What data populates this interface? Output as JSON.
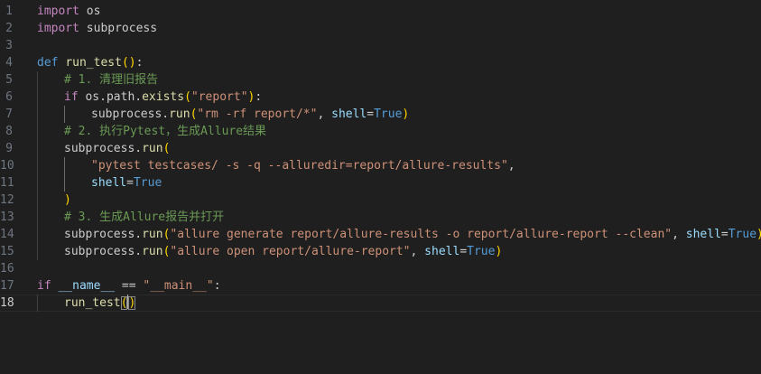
{
  "editor": {
    "language": "python",
    "current_line": 18,
    "colors": {
      "background": "#1f1f1f",
      "keyword": "#c586c0",
      "def": "#569cd6",
      "function": "#dcdcaa",
      "string": "#ce9178",
      "comment": "#6a9955",
      "param": "#9cdcfe",
      "constant": "#569cd6",
      "default": "#cccccc",
      "bracket1": "#ffd700",
      "bracket2": "#da70d6"
    },
    "lines": [
      {
        "number": "1",
        "indent": 0,
        "tokens": [
          {
            "t": "import",
            "c": "keyword"
          },
          {
            "t": " os",
            "c": "default"
          }
        ]
      },
      {
        "number": "2",
        "indent": 0,
        "tokens": [
          {
            "t": "import",
            "c": "keyword"
          },
          {
            "t": " subprocess",
            "c": "default"
          }
        ]
      },
      {
        "number": "3",
        "indent": 0,
        "tokens": []
      },
      {
        "number": "4",
        "indent": 0,
        "tokens": [
          {
            "t": "def",
            "c": "def"
          },
          {
            "t": " ",
            "c": "default"
          },
          {
            "t": "run_test",
            "c": "function"
          },
          {
            "t": "()",
            "c": "bracket1"
          },
          {
            "t": ":",
            "c": "default"
          }
        ]
      },
      {
        "number": "5",
        "indent": 1,
        "tokens": [
          {
            "t": "# 1. 清理旧报告",
            "c": "comment"
          }
        ]
      },
      {
        "number": "6",
        "indent": 1,
        "tokens": [
          {
            "t": "if",
            "c": "keyword"
          },
          {
            "t": " os.path.",
            "c": "default"
          },
          {
            "t": "exists",
            "c": "function"
          },
          {
            "t": "(",
            "c": "bracket1"
          },
          {
            "t": "\"report\"",
            "c": "string"
          },
          {
            "t": ")",
            "c": "bracket1"
          },
          {
            "t": ":",
            "c": "default"
          }
        ]
      },
      {
        "number": "7",
        "indent": 2,
        "tokens": [
          {
            "t": "subprocess.",
            "c": "default"
          },
          {
            "t": "run",
            "c": "function"
          },
          {
            "t": "(",
            "c": "bracket1"
          },
          {
            "t": "\"rm -rf report/*\"",
            "c": "string"
          },
          {
            "t": ", ",
            "c": "default"
          },
          {
            "t": "shell",
            "c": "param"
          },
          {
            "t": "=",
            "c": "default"
          },
          {
            "t": "True",
            "c": "constant"
          },
          {
            "t": ")",
            "c": "bracket1"
          }
        ]
      },
      {
        "number": "8",
        "indent": 1,
        "tokens": [
          {
            "t": "# 2. 执行Pytest，生成Allure结果",
            "c": "comment"
          }
        ]
      },
      {
        "number": "9",
        "indent": 1,
        "tokens": [
          {
            "t": "subprocess.",
            "c": "default"
          },
          {
            "t": "run",
            "c": "function"
          },
          {
            "t": "(",
            "c": "bracket1"
          }
        ]
      },
      {
        "number": "10",
        "indent": 2,
        "tokens": [
          {
            "t": "\"pytest testcases/ -s -q --alluredir=report/allure-results\"",
            "c": "string"
          },
          {
            "t": ",",
            "c": "default"
          }
        ]
      },
      {
        "number": "11",
        "indent": 2,
        "tokens": [
          {
            "t": "shell",
            "c": "param"
          },
          {
            "t": "=",
            "c": "default"
          },
          {
            "t": "True",
            "c": "constant"
          }
        ]
      },
      {
        "number": "12",
        "indent": 1,
        "tokens": [
          {
            "t": ")",
            "c": "bracket1"
          }
        ]
      },
      {
        "number": "13",
        "indent": 1,
        "tokens": [
          {
            "t": "# 3. 生成Allure报告并打开",
            "c": "comment"
          }
        ]
      },
      {
        "number": "14",
        "indent": 1,
        "tokens": [
          {
            "t": "subprocess.",
            "c": "default"
          },
          {
            "t": "run",
            "c": "function"
          },
          {
            "t": "(",
            "c": "bracket1"
          },
          {
            "t": "\"allure generate report/allure-results -o report/allure-report --clean\"",
            "c": "string"
          },
          {
            "t": ", ",
            "c": "default"
          },
          {
            "t": "shell",
            "c": "param"
          },
          {
            "t": "=",
            "c": "default"
          },
          {
            "t": "True",
            "c": "constant"
          },
          {
            "t": ")",
            "c": "bracket1"
          }
        ]
      },
      {
        "number": "15",
        "indent": 1,
        "tokens": [
          {
            "t": "subprocess.",
            "c": "default"
          },
          {
            "t": "run",
            "c": "function"
          },
          {
            "t": "(",
            "c": "bracket1"
          },
          {
            "t": "\"allure open report/allure-report\"",
            "c": "string"
          },
          {
            "t": ", ",
            "c": "default"
          },
          {
            "t": "shell",
            "c": "param"
          },
          {
            "t": "=",
            "c": "default"
          },
          {
            "t": "True",
            "c": "constant"
          },
          {
            "t": ")",
            "c": "bracket1"
          }
        ]
      },
      {
        "number": "16",
        "indent": 0,
        "tokens": []
      },
      {
        "number": "17",
        "indent": 0,
        "tokens": [
          {
            "t": "if",
            "c": "keyword"
          },
          {
            "t": " ",
            "c": "default"
          },
          {
            "t": "__name__",
            "c": "param"
          },
          {
            "t": " == ",
            "c": "default"
          },
          {
            "t": "\"__main__\"",
            "c": "string"
          },
          {
            "t": ":",
            "c": "default"
          }
        ]
      },
      {
        "number": "18",
        "indent": 1,
        "tokens": [
          {
            "t": "run_test",
            "c": "function"
          },
          {
            "t": "(",
            "c": "bracket1",
            "match": true
          },
          {
            "t": "CURSOR",
            "c": "cursor"
          },
          {
            "t": ")",
            "c": "bracket1",
            "match": true
          }
        ]
      }
    ]
  }
}
